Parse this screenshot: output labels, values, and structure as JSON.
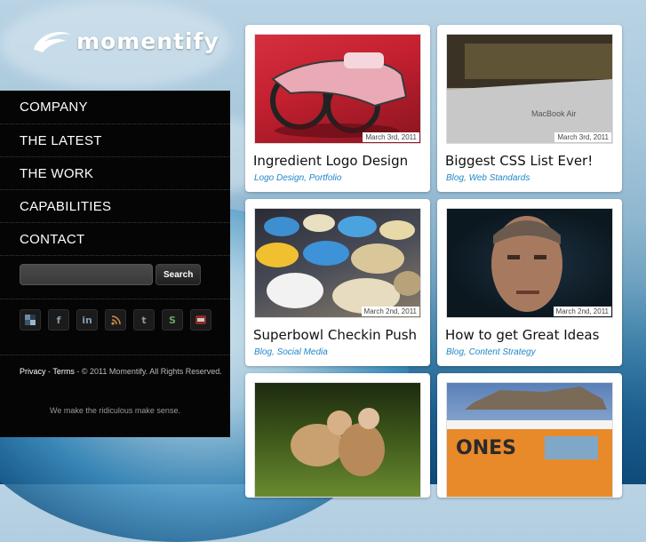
{
  "brand": {
    "name": "momentify"
  },
  "nav": [
    {
      "label": "COMPANY"
    },
    {
      "label": "THE LATEST"
    },
    {
      "label": "THE WORK"
    },
    {
      "label": "CAPABILITIES"
    },
    {
      "label": "CONTACT"
    }
  ],
  "search": {
    "placeholder": "",
    "button_label": "Search"
  },
  "socials": [
    "delicious-icon",
    "facebook-icon",
    "linkedin-icon",
    "rss-icon",
    "twitter-icon",
    "skype-icon",
    "youtube-icon"
  ],
  "footer": {
    "privacy": "Privacy",
    "sep1": " - ",
    "terms": "Terms",
    "copyright": " - © 2011 Momentify. All Rights Reserved.",
    "tagline": "We make the ridiculous make sense."
  },
  "posts": [
    {
      "title": "Ingredient Logo Design",
      "date": "March 3rd, 2011",
      "tags": [
        "Logo Design",
        "Portfolio"
      ]
    },
    {
      "title": "Biggest CSS List Ever!",
      "date": "March 3rd, 2011",
      "tags": [
        "Blog",
        "Web Standards"
      ]
    },
    {
      "title": "Superbowl Checkin Push",
      "date": "March 2nd, 2011",
      "tags": [
        "Blog",
        "Social Media"
      ]
    },
    {
      "title": "How to get Great Ideas",
      "date": "March 2nd, 2011",
      "tags": [
        "Blog",
        "Content Strategy"
      ]
    },
    {
      "title": "",
      "date": "",
      "tags": []
    },
    {
      "title": "",
      "date": "",
      "tags": []
    }
  ],
  "colors": {
    "sidebar_bg": "#050505",
    "tag_link": "#1e88c8",
    "card_bg": "#ffffff"
  }
}
